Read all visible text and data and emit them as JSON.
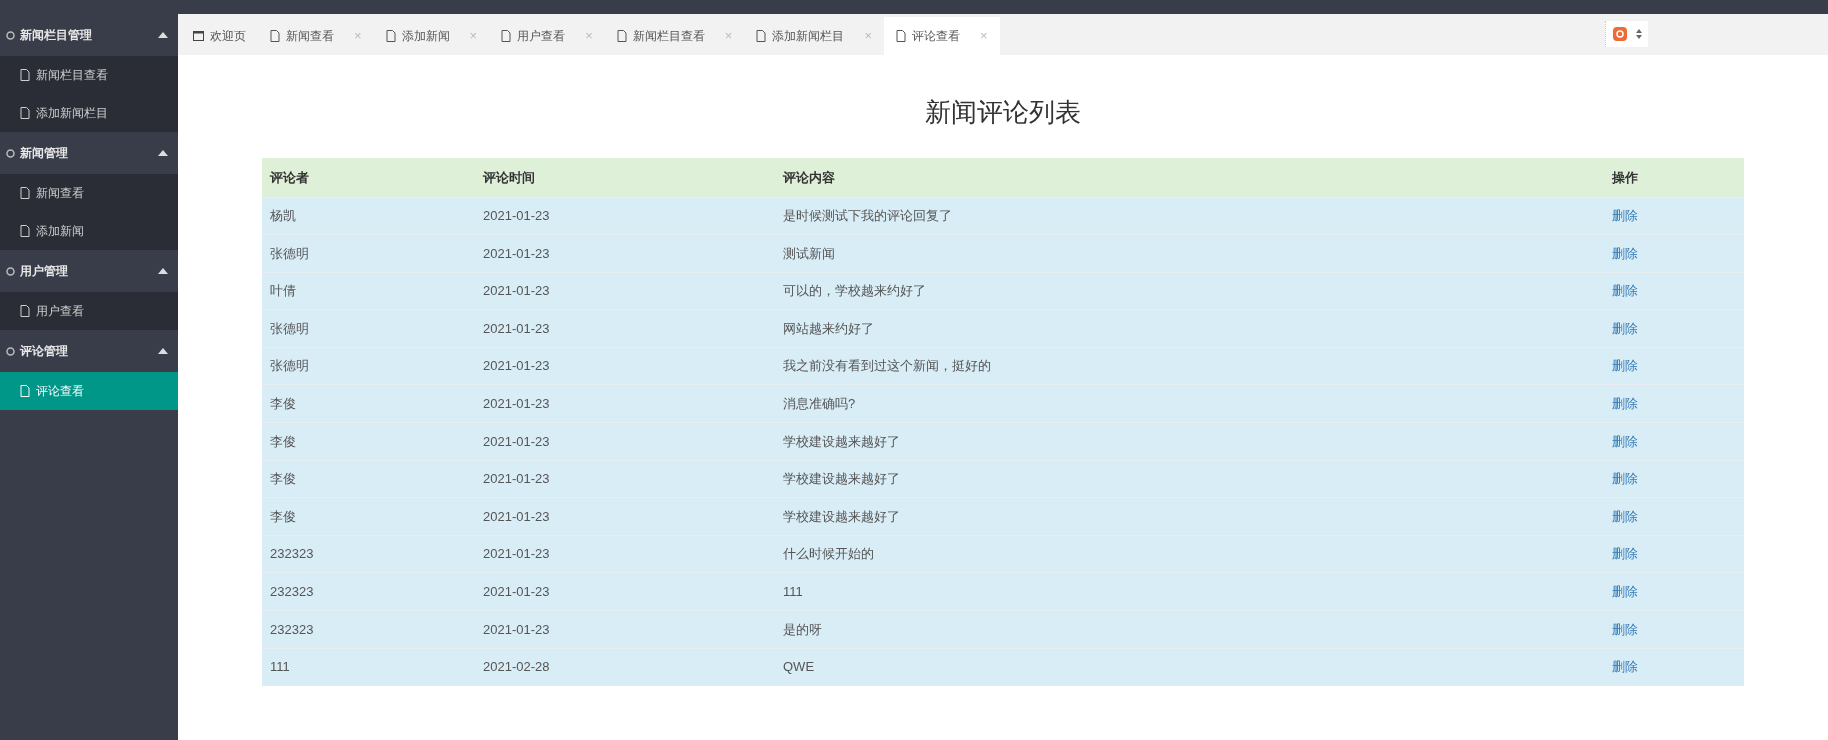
{
  "sidebar": {
    "groups": [
      {
        "label": "新闻栏目管理",
        "expanded": true,
        "items": [
          {
            "label": "新闻栏目查看",
            "selected": false
          },
          {
            "label": "添加新闻栏目",
            "selected": false
          }
        ]
      },
      {
        "label": "新闻管理",
        "expanded": true,
        "items": [
          {
            "label": "新闻查看",
            "selected": false
          },
          {
            "label": "添加新闻",
            "selected": false
          }
        ]
      },
      {
        "label": "用户管理",
        "expanded": true,
        "items": [
          {
            "label": "用户查看",
            "selected": false
          }
        ]
      },
      {
        "label": "评论管理",
        "expanded": true,
        "items": [
          {
            "label": "评论查看",
            "selected": true
          }
        ]
      }
    ]
  },
  "tabs": [
    {
      "label": "欢迎页",
      "kind": "home",
      "selected": false
    },
    {
      "label": "新闻查看",
      "kind": "page",
      "selected": false,
      "close": "×"
    },
    {
      "label": "添加新闻",
      "kind": "page",
      "selected": false,
      "close": "×"
    },
    {
      "label": "用户查看",
      "kind": "page",
      "selected": false,
      "close": "×"
    },
    {
      "label": "新闻栏目查看",
      "kind": "page",
      "selected": false,
      "close": "×"
    },
    {
      "label": "添加新闻栏目",
      "kind": "page",
      "selected": false,
      "close": "×"
    },
    {
      "label": "评论查看",
      "kind": "page",
      "selected": true,
      "close": "×"
    }
  ],
  "page_title": "新闻评论列表",
  "table": {
    "columns": [
      "评论者",
      "评论时间",
      "评论内容",
      "操作"
    ],
    "rows": [
      [
        "杨凯",
        "2021-01-23",
        "是时候测试下我的评论回复了",
        "删除"
      ],
      [
        "张德明",
        "2021-01-23",
        "测试新闻",
        "删除"
      ],
      [
        "叶倩",
        "2021-01-23",
        "可以的，学校越来约好了",
        "删除"
      ],
      [
        "张德明",
        "2021-01-23",
        "网站越来约好了",
        "删除"
      ],
      [
        "张德明",
        "2021-01-23",
        "我之前没有看到过这个新闻，挺好的",
        "删除"
      ],
      [
        "李俊",
        "2021-01-23",
        "消息准确吗?",
        "删除"
      ],
      [
        "李俊",
        "2021-01-23",
        "学校建设越来越好了",
        "删除"
      ],
      [
        "李俊",
        "2021-01-23",
        "学校建设越来越好了",
        "删除"
      ],
      [
        "李俊",
        "2021-01-23",
        "学校建设越来越好了",
        "删除"
      ],
      [
        "232323",
        "2021-01-23",
        "什么时候开始的",
        "删除"
      ],
      [
        "232323",
        "2021-01-23",
        "111",
        "删除"
      ],
      [
        "232323",
        "2021-01-23",
        "是的呀",
        "删除"
      ],
      [
        "111",
        "2021-02-28",
        "QWE",
        "删除"
      ]
    ]
  }
}
